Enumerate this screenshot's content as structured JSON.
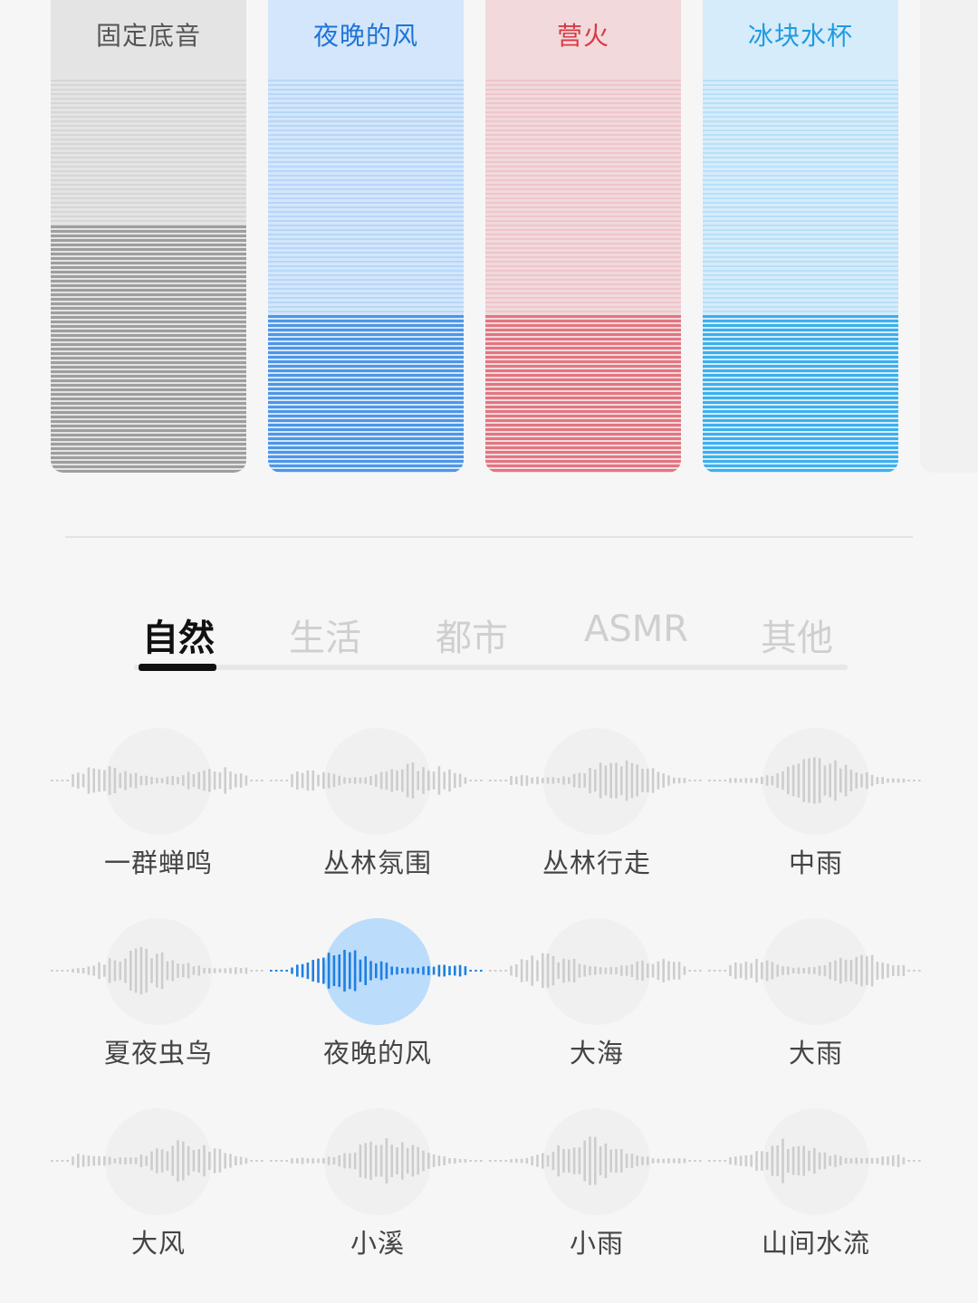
{
  "mixer": {
    "cards": [
      {
        "title": "固定底音",
        "title_color": "#555555",
        "top_color": "#e4e4e4",
        "line_color": "#9e9e9e",
        "fill_level": 0.63
      },
      {
        "title": "夜晚的风",
        "title_color": "#1f73d6",
        "top_color": "#d3e6fb",
        "line_color": "#4d96e6",
        "fill_level": 0.4
      },
      {
        "title": "营火",
        "title_color": "#d83a45",
        "top_color": "#f1d9dc",
        "line_color": "#e37580",
        "fill_level": 0.4
      },
      {
        "title": "冰块水杯",
        "title_color": "#1f9be0",
        "top_color": "#d6ecfb",
        "line_color": "#3bb0ef",
        "fill_level": 0.4
      }
    ]
  },
  "tabs": [
    {
      "label": "自然",
      "active": true
    },
    {
      "label": "生活",
      "active": false
    },
    {
      "label": "都市",
      "active": false
    },
    {
      "label": "ASMR",
      "active": false
    },
    {
      "label": "其他",
      "active": false
    }
  ],
  "sounds": [
    {
      "label": "一群蝉鸣",
      "selected": false
    },
    {
      "label": "丛林氛围",
      "selected": false
    },
    {
      "label": "丛林行走",
      "selected": false
    },
    {
      "label": "中雨",
      "selected": false
    },
    {
      "label": "夏夜虫鸟",
      "selected": false
    },
    {
      "label": "夜晚的风",
      "selected": true
    },
    {
      "label": "大海",
      "selected": false
    },
    {
      "label": "大雨",
      "selected": false
    },
    {
      "label": "大风",
      "selected": false
    },
    {
      "label": "小溪",
      "selected": false
    },
    {
      "label": "小雨",
      "selected": false
    },
    {
      "label": "山间水流",
      "selected": false
    }
  ],
  "colors": {
    "wave_inactive": "#cdcdcd",
    "wave_active": "#1f7fe0",
    "bubble_active": "#bcdcfb"
  }
}
